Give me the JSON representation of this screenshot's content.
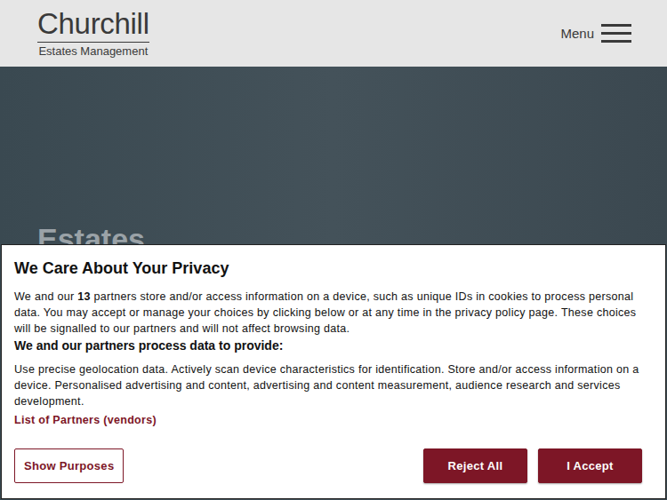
{
  "header": {
    "logo": {
      "title": "Churchill",
      "subtitle": "Estates Management"
    },
    "menu": {
      "label": "Menu"
    }
  },
  "hero": {
    "heading": "Estates"
  },
  "consent": {
    "title": "We Care About Your Privacy",
    "intro_before": "We and our ",
    "partner_count": "13",
    "intro_after": " partners store and/or access information on a device, such as unique IDs in cookies to process personal data. You may accept or manage your choices by clicking below or at any time in the privacy policy page. These choices will be signalled to our partners and will not affect browsing data.",
    "purposes_heading": "We and our partners process data to provide:",
    "purposes": "Use precise geolocation data. Actively scan device characteristics for identification. Store and/or access information on a device. Personalised advertising and content, advertising and content measurement, audience research and services development.",
    "partners_link": "List of Partners (vendors)",
    "buttons": [
      {
        "label": "Show Purposes",
        "kind": "outline"
      },
      {
        "label": "Reject All",
        "kind": "filled"
      },
      {
        "label": "I Accept",
        "kind": "filled"
      }
    ]
  }
}
